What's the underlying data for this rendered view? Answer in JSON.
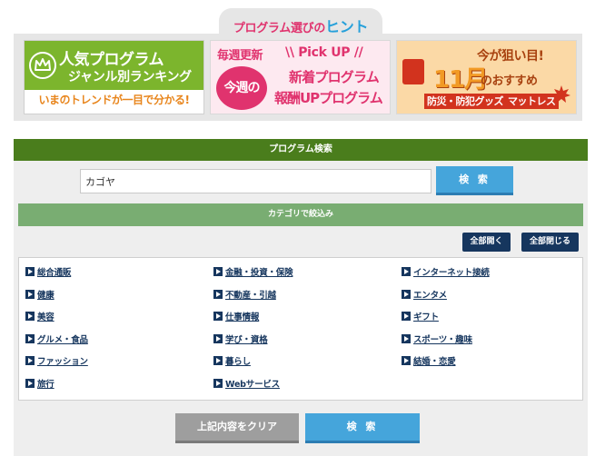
{
  "hint_tab": {
    "text": "プログラム選びの",
    "accent": "ヒント"
  },
  "banners": {
    "ranking": {
      "line1": "人気プログラム",
      "line2": "ジャンル別ランキング",
      "bottom": "いまのトレンドが一目で分かる!",
      "icon": "crown-icon"
    },
    "pickup": {
      "weekly": "毎週更新",
      "circle": "今週の",
      "pick": "\\\\ Pick UP //",
      "line1": "新着プログラム",
      "line2": "報酬UPプログラム"
    },
    "monthly": {
      "line1": "今が狙い目!",
      "big": "11月",
      "line2": "のおすすめ",
      "tag1": "防災・防犯グッズ",
      "tag2": "マットレス"
    }
  },
  "search": {
    "header": "プログラム検索",
    "input_value": "カゴヤ",
    "button": "検 索"
  },
  "categories": {
    "header": "カテゴリで絞込み",
    "open_all": "全部開く",
    "close_all": "全部閉じる",
    "columns": [
      [
        "総合通販",
        "健康",
        "美容",
        "グルメ・食品",
        "ファッション",
        "旅行"
      ],
      [
        "金融・投資・保険",
        "不動産・引越",
        "仕事情報",
        "学び・資格",
        "暮らし",
        "Webサービス"
      ],
      [
        "インターネット接続",
        "エンタメ",
        "ギフト",
        "スポーツ・趣味",
        "結婚・恋愛"
      ]
    ]
  },
  "footer": {
    "clear": "上記内容をクリア",
    "search": "検 索"
  },
  "colors": {
    "green_header": "#4a7d1c",
    "light_green": "#79ad72",
    "blue_button": "#45a5db",
    "navy": "#16365e",
    "pink": "#e0336e"
  }
}
